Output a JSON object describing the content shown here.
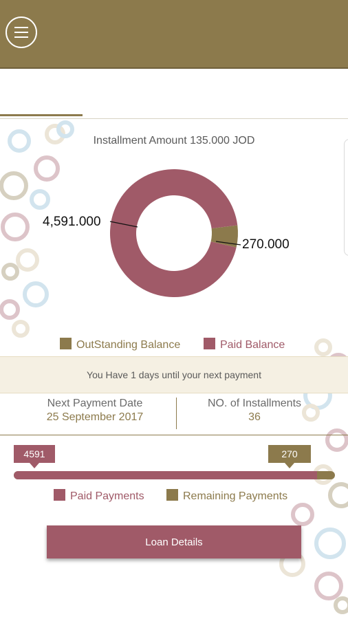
{
  "header": {
    "title": "",
    "menu_icon": "hamburger-menu-icon"
  },
  "tabs": [
    {
      "label": ""
    },
    {
      "label": ""
    },
    {
      "label": ""
    },
    {
      "label": ""
    },
    {
      "label": ""
    }
  ],
  "installment": {
    "amount_text": "Installment Amount 135.000 JOD"
  },
  "balance_chart": {
    "outstanding_label": "270.000",
    "paid_label": "4,591.000",
    "legend_outstanding": "OutStanding Balance",
    "legend_paid": "Paid Balance"
  },
  "chart_data": {
    "type": "pie",
    "title": "",
    "labels": [
      "OutStanding Balance",
      "Paid Balance"
    ],
    "values": [
      270.0,
      4591.0
    ],
    "data_labels": [
      "270.000",
      "4,591.000"
    ],
    "colors": [
      "#8c7a4c",
      "#a05a68"
    ],
    "donut": true
  },
  "notice": {
    "text": "You Have 1 days until your next payment"
  },
  "next_payment": {
    "label": "Next Payment Date",
    "value": "25 September 2017"
  },
  "installments": {
    "label": "NO. of Installments",
    "value": "36"
  },
  "payments_progress": {
    "paid_value": "4591",
    "remaining_value": "270",
    "paid_fraction": 0.944,
    "legend_paid": "Paid Payments",
    "legend_remaining": "Remaining Payments"
  },
  "loan_button": {
    "label": "Loan Details"
  },
  "colors": {
    "gold": "#8c7a4c",
    "rose": "#a05a68",
    "notice_bg": "#f5f0e3"
  }
}
